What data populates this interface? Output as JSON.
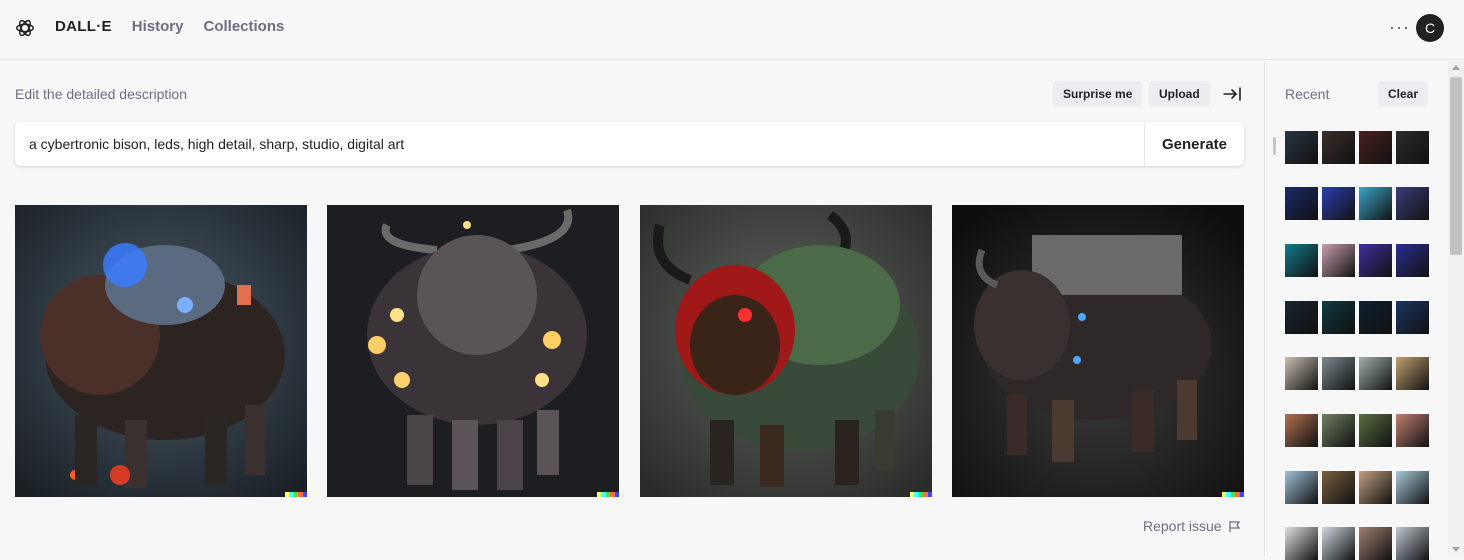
{
  "header": {
    "logo_icon": "openai-logo-icon",
    "brand": "DALL·E",
    "nav": [
      "History",
      "Collections"
    ],
    "more_icon": "more-dots-icon",
    "more_label": "···",
    "avatar_letter": "C"
  },
  "editor": {
    "description_label": "Edit the detailed description",
    "surprise_label": "Surprise me",
    "upload_label": "Upload",
    "collapse_icon": "collapse-sidebar-icon",
    "prompt_value": "a cybertronic bison, leds, high detail, sharp, studio, digital art",
    "generate_label": "Generate"
  },
  "results": {
    "images": [
      {
        "name": "generated-image-1",
        "accent": "#3b7bff"
      },
      {
        "name": "generated-image-2",
        "accent": "#ffcf66"
      },
      {
        "name": "generated-image-3",
        "accent": "#e02828"
      },
      {
        "name": "generated-image-4",
        "accent": "#4aa8ff"
      }
    ],
    "signature_colors": [
      "#ffff66",
      "#42ffff",
      "#51da4c",
      "#ff6e3c",
      "#3c46ff"
    ],
    "report_label": "Report issue",
    "report_icon": "flag-icon"
  },
  "sidebar": {
    "recent_label": "Recent",
    "clear_label": "Clear",
    "thumb_rows": [
      [
        "#2a3440",
        "#3a2e2a",
        "#4a2020",
        "#2a2a30"
      ],
      [
        "#1b2a6a",
        "#2b3fb0",
        "#3aa6c8",
        "#3a3d78"
      ],
      [
        "#127a8a",
        "#c8a0b0",
        "#4030a0",
        "#2a2e90"
      ],
      [
        "#1a2430",
        "#0f3a40",
        "#0e2030",
        "#1a3560"
      ],
      [
        "#c8c0b0",
        "#7a8a90",
        "#a0b0a8",
        "#c0a070"
      ],
      [
        "#b07050",
        "#708060",
        "#5a7040",
        "#c08070"
      ],
      [
        "#a0c0d8",
        "#7a6040",
        "#c0a080",
        "#a8c8d8"
      ],
      [
        "#e0e0e0",
        "#d0d8e0",
        "#a08070",
        "#c0c8d0"
      ]
    ]
  }
}
